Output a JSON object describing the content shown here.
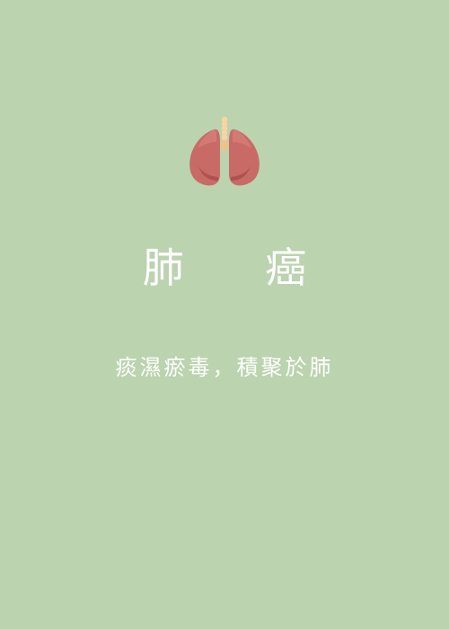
{
  "title": "肺 癌",
  "subtitle": "痰濕瘀毒，積聚於肺",
  "icon": "lungs-icon",
  "colors": {
    "background": "#bbd3ae",
    "text": "#ffffff",
    "lung": "#c86a66",
    "lung_shadow": "#a94d4d",
    "trachea": "#e9c48f"
  }
}
